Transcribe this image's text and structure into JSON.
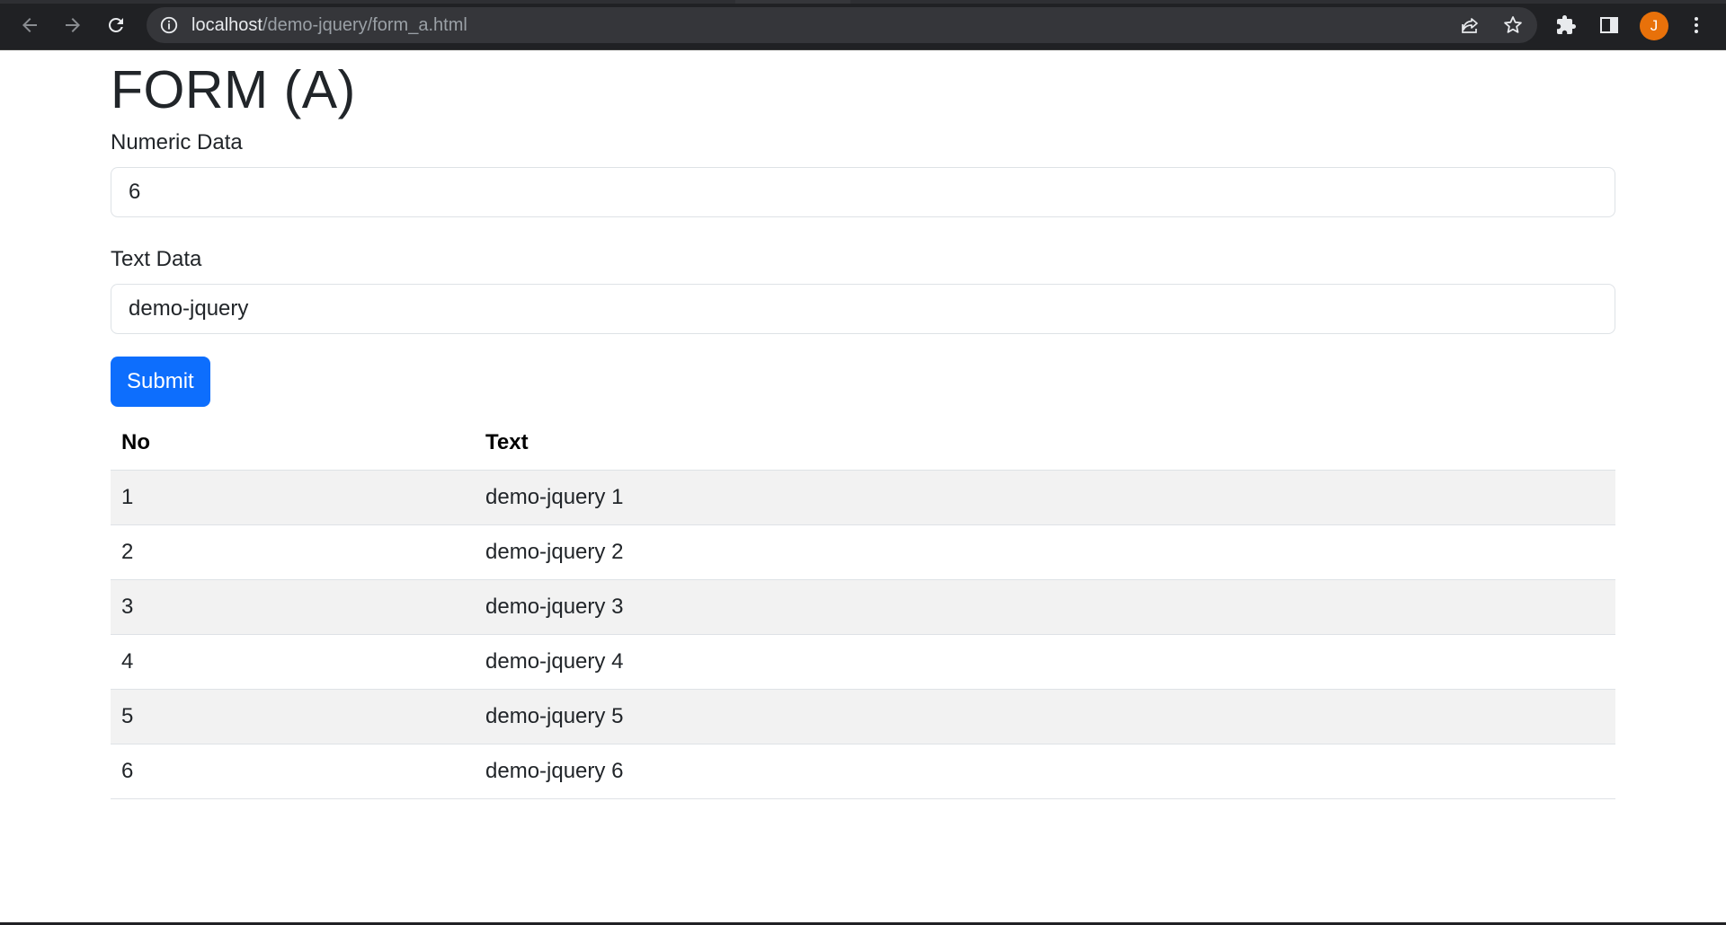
{
  "browser": {
    "url_host": "localhost",
    "url_path": "/demo-jquery/form_a.html",
    "profile_initial": "J"
  },
  "form": {
    "title": "FORM (A)",
    "numeric_label": "Numeric Data",
    "numeric_value": "6",
    "text_label": "Text Data",
    "text_value": "demo-jquery",
    "submit_label": "Submit"
  },
  "table": {
    "headers": [
      "No",
      "Text"
    ],
    "rows": [
      [
        "1",
        "demo-jquery 1"
      ],
      [
        "2",
        "demo-jquery 2"
      ],
      [
        "3",
        "demo-jquery 3"
      ],
      [
        "4",
        "demo-jquery 4"
      ],
      [
        "5",
        "demo-jquery 5"
      ],
      [
        "6",
        "demo-jquery 6"
      ]
    ]
  },
  "colors": {
    "primary": "#0d6efd",
    "chrome_bg": "#202124",
    "stripe": "#f2f2f2",
    "avatar": "#e8710a"
  }
}
